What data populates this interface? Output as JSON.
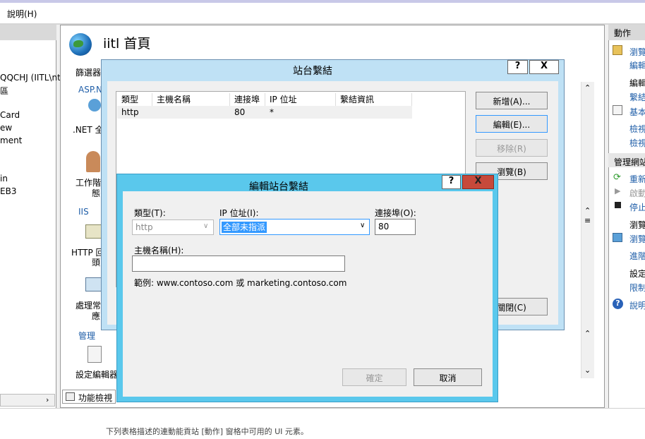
{
  "menu": {
    "help": "說明(H)"
  },
  "tree": {
    "items": [
      "QQCHJ (IITL\\nt",
      "區",
      "Card",
      "ew",
      "ment",
      "in",
      "EB3"
    ]
  },
  "header": {
    "title": "iitl 首頁",
    "filter_label": "篩選器"
  },
  "features": {
    "group_aspnet": "ASP.N",
    "dotnet": ".NET 全",
    "session_1": "工作階",
    "session_2": "態",
    "group_iis": "IIS",
    "http_1": "HTTP 回",
    "http_2": "頭",
    "handler_1": "處理常",
    "handler_2": "應",
    "group_manage": "管理",
    "config_editor": "設定編輯器",
    "feature_view": "功能檢視"
  },
  "status_text": "下列表格描述的連動能貢站 [動作] 窗格中可用的 UI 元素。",
  "actions": {
    "header": "動作",
    "browse": "瀏覽",
    "edit_perm": "編輯",
    "edit_site": "編輯",
    "bindings": "繫結",
    "basic": "基本",
    "view_apps": "檢視",
    "view_vdirs": "檢視",
    "manage_site": "管理網站",
    "restart": "重新",
    "start": "啟動",
    "stop": "停止",
    "browse_hdr": "瀏覽",
    "browse_80": "瀏覽",
    "advanced": "進階",
    "configure": "設定",
    "limits": "限制",
    "help": "說明"
  },
  "bindings_dialog": {
    "title": "站台繫結",
    "help_btn": "?",
    "close_btn": "X",
    "columns": [
      "類型",
      "主機名稱",
      "連接埠",
      "IP 位址",
      "繫結資訊"
    ],
    "rows": [
      {
        "type": "http",
        "host": "",
        "port": "80",
        "ip": "*",
        "info": ""
      }
    ],
    "add": "新增(A)...",
    "edit": "編輯(E)...",
    "remove": "移除(R)",
    "browse": "瀏覽(B)",
    "close": "關閉(C)"
  },
  "edit_dialog": {
    "title": "編輯站台繫結",
    "help_btn": "?",
    "close_btn": "X",
    "type_label": "類型(T):",
    "type_value": "http",
    "ip_label": "IP 位址(I):",
    "ip_value": "全部未指派",
    "port_label": "連接埠(O):",
    "port_value": "80",
    "host_label": "主機名稱(H):",
    "host_value": "",
    "example": "範例: www.contoso.com 或 marketing.contoso.com",
    "ok": "確定",
    "cancel": "取消"
  },
  "colors": {
    "dialog_frame": "#bfe1f5",
    "dialog_active": "#5ac8ec",
    "close_red": "#c7493b",
    "selection": "#3399ff"
  }
}
